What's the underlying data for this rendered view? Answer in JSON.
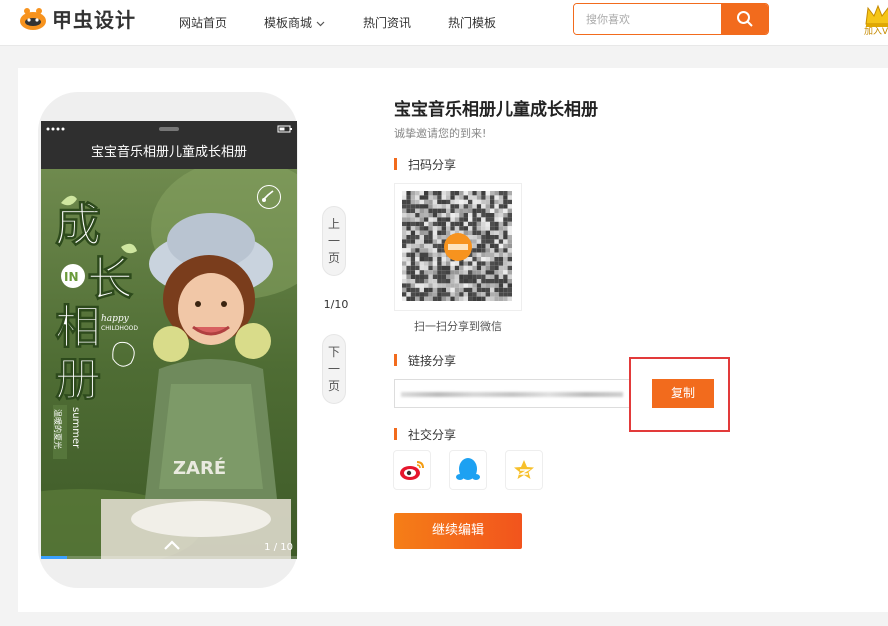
{
  "header": {
    "logo_text": "甲虫设计",
    "nav": [
      "网站首页",
      "模板商城",
      "热门资讯",
      "热门模板"
    ],
    "search_placeholder": "搜你喜欢",
    "vip_label": "加入V"
  },
  "phone": {
    "title": "宝宝音乐相册儿童成长相册",
    "page_badge": "1 / 10",
    "progress": 0.1,
    "cover_text": {
      "big1": "成",
      "big2": "长",
      "big3": "相",
      "big4": "册",
      "in": "IN",
      "happy": "happy",
      "childhood": "CHILDHOOD",
      "summer": "summer",
      "side_cn": "温暖的夏光",
      "shirt": "ZARÉ"
    }
  },
  "pager": {
    "prev": [
      "上",
      "一",
      "页"
    ],
    "count": "1/10",
    "next": [
      "下",
      "一",
      "页"
    ]
  },
  "share": {
    "title": "宝宝音乐相册儿童成长相册",
    "subtitle": "诚挚邀请您的到来!",
    "qr_section": "扫码分享",
    "qr_caption": "扫一扫分享到微信",
    "link_section": "链接分享",
    "copy_label": "复制",
    "social_section": "社交分享",
    "continue_label": "继续编辑"
  },
  "colors": {
    "accent": "#f26b1d",
    "highlight_box": "#e23a3a"
  }
}
